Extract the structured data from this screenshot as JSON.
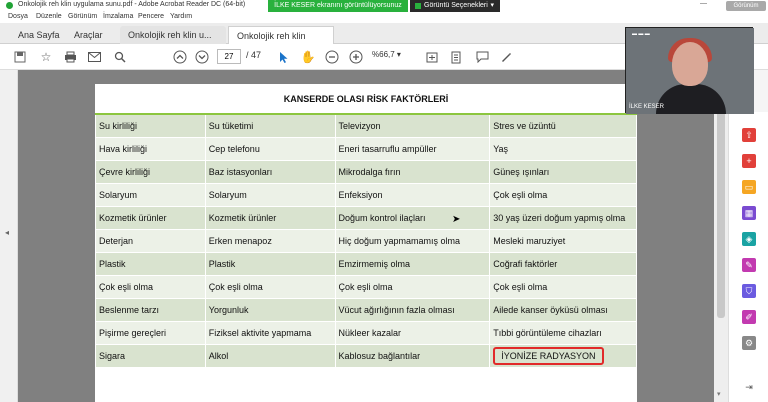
{
  "window": {
    "title": "Onkolojik reh klin uygulama sunu.pdf - Adobe Acrobat Reader DC (64-bit)",
    "minimize": "—"
  },
  "menu": [
    "Dosya",
    "Düzenle",
    "Görünüm",
    "İmzalama",
    "Pencere",
    "Yardım"
  ],
  "share": {
    "banner": "İLKE KESER ekranını görüntülüyorsunuz",
    "view_options": "Görüntü Seçenekleri",
    "view_chevron": "▾",
    "view_pill": "Görünüm"
  },
  "tabs": {
    "home": "Ana Sayfa",
    "tools": "Araçlar",
    "doc1": "Onkolojik reh klin u...",
    "doc2": "Onkolojik reh klin u...",
    "close": "×"
  },
  "toolbar": {
    "page_current": "27",
    "page_total": "/ 47",
    "zoom": "%66,7"
  },
  "slide": {
    "title": "KANSERDE OLASI RİSK FAKTÖRLERİ",
    "rows": [
      [
        "Su kirliliği",
        "Su tüketimi",
        "Televizyon",
        "Stres ve üzüntü"
      ],
      [
        "Hava kirliliği",
        "Cep telefonu",
        "Eneri tasarruflu ampüller",
        "Yaş"
      ],
      [
        "Çevre kirliliği",
        "Baz istasyonları",
        "Mikrodalga fırın",
        "Güneş ışınları"
      ],
      [
        "Solaryum",
        "Solaryum",
        "Enfeksiyon",
        "Çok eşli olma"
      ],
      [
        "Kozmetik ürünler",
        "Kozmetik ürünler",
        "Doğum kontrol ilaçları",
        "30 yaş üzeri doğum yapmış olma"
      ],
      [
        "Deterjan",
        "Erken menapoz",
        "Hiç doğum yapmamamış olma",
        "Mesleki maruziyet"
      ],
      [
        "Plastik",
        "Plastik",
        "Emzirmemiş olma",
        "Coğrafi faktörler"
      ],
      [
        "Çok eşli olma",
        "Çok eşli olma",
        "Çok eşli olma",
        "Çok eşli olma"
      ],
      [
        "Beslenme tarzı",
        "Yorgunluk",
        "Vücut ağırlığının fazla olması",
        "Ailede kanser öyküsü olması"
      ],
      [
        "Pişirme gereçleri",
        "Fiziksel aktivite yapmama",
        "Nükleer kazalar",
        "Tıbbi görüntüleme cihazları"
      ],
      [
        "Sigara",
        "Alkol",
        "Kablosuz bağlantılar",
        "İYONİZE RADYASYON"
      ]
    ],
    "highlight_color": "#e12a2a",
    "accent_color": "#8cc63f"
  },
  "webcam": {
    "participant": "İLKE KESER"
  }
}
